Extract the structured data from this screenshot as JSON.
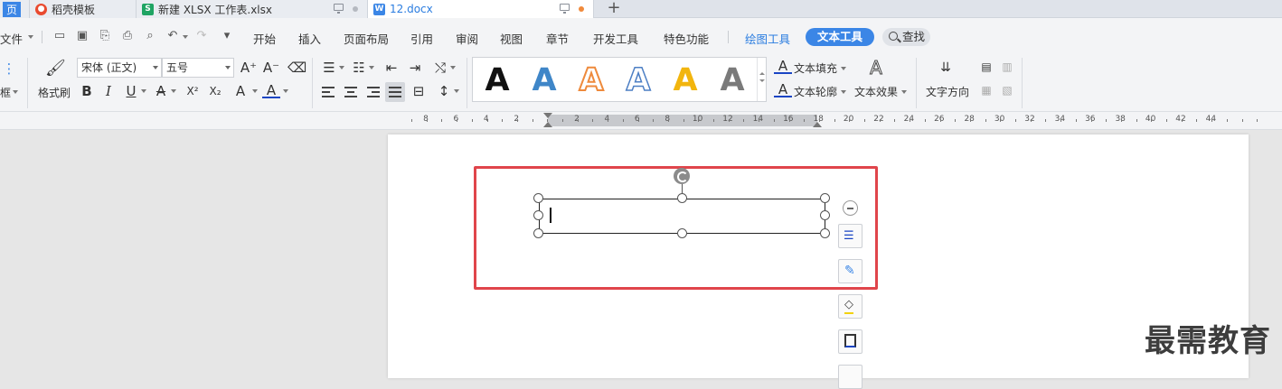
{
  "tabs": [
    {
      "label": "页",
      "icon": "home-icon"
    },
    {
      "label": "稻壳模板",
      "icon": "docer-icon",
      "color": "#e94a2f"
    },
    {
      "label": "新建 XLSX 工作表.xlsx",
      "icon": "spreadsheet-icon",
      "color": "#1fa463"
    },
    {
      "label": "12.docx",
      "icon": "word-doc-icon",
      "color": "#3b86e6"
    }
  ],
  "new_tab": "+",
  "menu": {
    "file": "文件",
    "items": [
      "开始",
      "插入",
      "页面布局",
      "引用",
      "审阅",
      "视图",
      "章节",
      "开发工具",
      "特色功能"
    ],
    "drawing_tools": "绘图工具",
    "text_tools": "文本工具",
    "search": "查找"
  },
  "toolbar": {
    "left_cut": "框",
    "format_painter": "格式刷",
    "font_name": "宋体 (正文)",
    "font_size": "五号",
    "text_fill": "文本填充",
    "text_outline": "文本轮廓",
    "text_effect": "文本效果",
    "text_direction": "文字方向",
    "style_letter": "A",
    "style_colors": [
      "#111111",
      "#3f86c8",
      "#ee8a3c",
      "#4d7fc4",
      "#f2b50e",
      "#7a7a7a"
    ],
    "buttons": {
      "bold": "B",
      "italic": "I",
      "underline": "U",
      "strike": "A",
      "superscript": "X²",
      "subscript": "X₂",
      "highlight": "A",
      "font_color": "A",
      "grow": "A⁺",
      "shrink": "A⁻"
    }
  },
  "ruler": {
    "labels": [
      "8",
      "6",
      "4",
      "2",
      "2",
      "4",
      "6",
      "8",
      "10",
      "12",
      "14",
      "16",
      "18",
      "20",
      "22",
      "24",
      "26",
      "28",
      "30",
      "32",
      "34",
      "36",
      "38",
      "40",
      "42",
      "44"
    ]
  },
  "watermark": "最需教育"
}
